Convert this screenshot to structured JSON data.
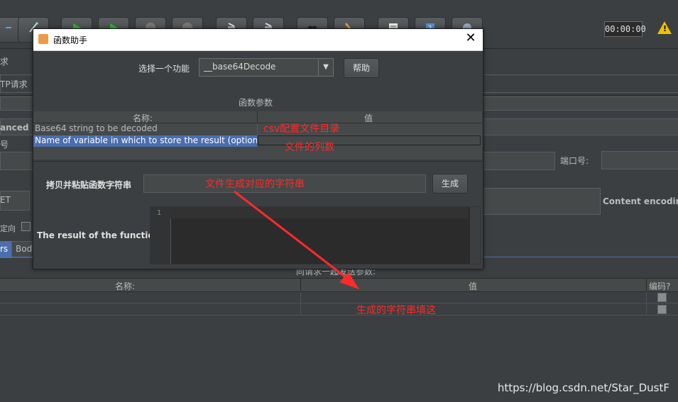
{
  "toolbar": {
    "icons": [
      "collapse-icon",
      "wand-icon",
      "start-icon",
      "start-no-pause-icon",
      "stop-icon",
      "shutdown-icon",
      "clear-icon",
      "clear-all-icon",
      "search-icon",
      "broom-icon",
      "function-helper-icon",
      "help-icon",
      "remote-icon"
    ],
    "timer": "00:00:00",
    "warning_count": "!"
  },
  "background": {
    "left_labels": [
      "求",
      "TP请求",
      "anced",
      "号",
      "ET",
      "定向",
      "rs",
      "Body"
    ],
    "port_label": "端口号:",
    "content_encoding_label": "Content encoding:",
    "params_caption": "同请求一起发送参数:",
    "table": {
      "col_name": "名称:",
      "col_value": "值",
      "col_encode": "编码?",
      "rows": [
        {
          "name": "",
          "value": ""
        },
        {
          "name": "",
          "value": ""
        }
      ]
    }
  },
  "dialog": {
    "title": "函数助手",
    "choose_label": "选择一个功能",
    "selected_function": "__base64Decode",
    "help_button": "帮助",
    "params_title": "函数参数",
    "params_table": {
      "col_name": "名称:",
      "col_value": "值",
      "rows": [
        {
          "name": "Base64 string to be decoded",
          "value": ""
        },
        {
          "name": "Name of variable in which to store the result (optional)",
          "value": ""
        }
      ]
    },
    "copy_label": "拷贝并粘贴函数字符串",
    "copy_value": "",
    "generate_button": "生成",
    "result_label": "The result of the function is",
    "line_number": "1"
  },
  "annotations": {
    "a1": "csv配置文件目录",
    "a2": "文件的列数",
    "a3": "文件生成对应的字符串",
    "a4": "生成的字符串填这",
    "arrow_color": "#ff2a2a"
  },
  "watermark": "https://blog.csdn.net/Star_DustF"
}
